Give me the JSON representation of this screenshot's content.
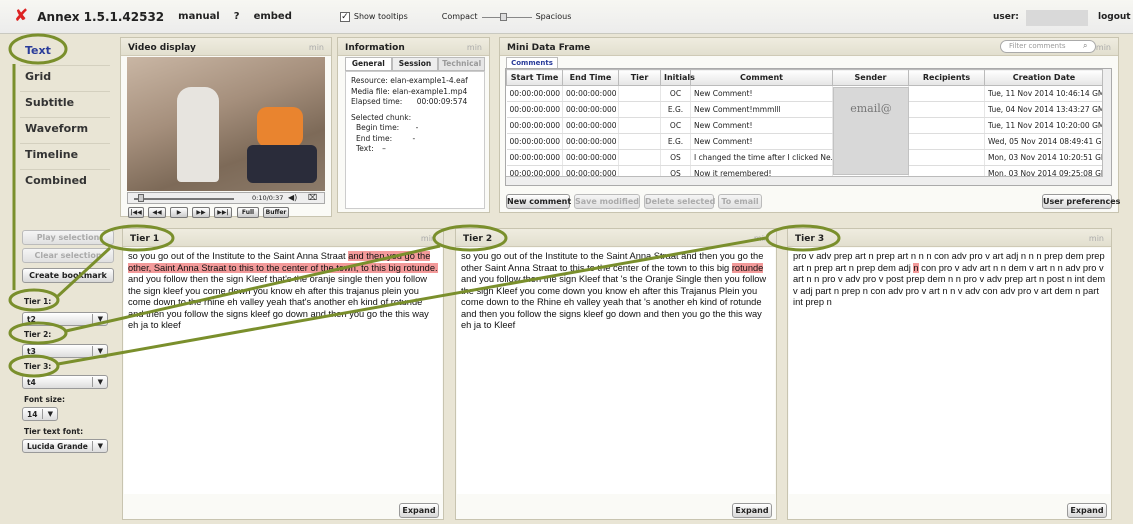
{
  "app": {
    "title": "Annex 1.5.1.42532",
    "manual": "manual",
    "help": "?",
    "embed": "embed",
    "tooltips_label": "Show tooltips",
    "compact": "Compact",
    "spacious": "Spacious",
    "user_label": "user:",
    "logout": "logout"
  },
  "nav": {
    "items": [
      "Text",
      "Grid",
      "Subtitle",
      "Waveform",
      "Timeline",
      "Combined"
    ],
    "active": "Text"
  },
  "video": {
    "title": "Video display",
    "min": "min",
    "time": "0:10/0:37",
    "full": "Full",
    "buffer": "Buffer"
  },
  "info": {
    "title": "Information",
    "min": "min",
    "tabs": [
      "General",
      "Session",
      "Technical"
    ],
    "resource": "Resource:  elan-example1-4.eaf",
    "media": "Media file:  elan-example1.mp4",
    "elapsed": "Elapsed time:",
    "elapsed_val": "00:00:09:574",
    "chunk": "Selected chunk:",
    "begin": "Begin time:",
    "begin_val": "-",
    "end": "End time:",
    "end_val": "-",
    "text": "Text:",
    "text_val": "–"
  },
  "mdf": {
    "title": "Mini Data Frame",
    "filter_placeholder": "Filter comments",
    "min": "min",
    "tab": "Comments",
    "columns": [
      "Start Time",
      "End Time",
      "Tier",
      "Initials",
      "Comment",
      "Sender",
      "Recipients",
      "Creation Date"
    ],
    "rows": [
      [
        "00:00:00:000",
        "00:00:00:000",
        "",
        "OC",
        "New Comment!",
        "",
        "",
        "Tue, 11 Nov 2014 10:46:14 GMT"
      ],
      [
        "00:00:00:000",
        "00:00:00:000",
        "",
        "E.G.",
        "New Comment!mmmlll",
        "",
        "",
        "Tue, 04 Nov 2014 13:43:27 GMT"
      ],
      [
        "00:00:00:000",
        "00:00:00:000",
        "",
        "OC",
        "New Comment!",
        "",
        "",
        "Tue, 11 Nov 2014 10:20:00 GMT"
      ],
      [
        "00:00:00:000",
        "00:00:00:000",
        "",
        "E.G.",
        "New Comment!",
        "",
        "",
        "Wed, 05 Nov 2014 08:49:41 GMT"
      ],
      [
        "00:00:00:000",
        "00:00:00:000",
        "",
        "OS",
        "I changed the time after I clicked Ne...",
        "",
        "",
        "Mon, 03 Nov 2014 10:20:51 GMT"
      ],
      [
        "00:00:00:000",
        "00:00:00:000",
        "",
        "OS",
        "Now it remembered!",
        "",
        "",
        "Mon, 03 Nov 2014 09:25:08 GMT"
      ]
    ],
    "email_overlay": "email@",
    "buttons": {
      "new": "New comment",
      "save": "Save modified",
      "delete": "Delete selected",
      "email": "To email",
      "prefs": "User preferences"
    }
  },
  "controls": {
    "play": "Play selection",
    "clear": "Clear selection",
    "bookmark": "Create bookmark",
    "tier1_label": "Tier 1:",
    "tier1_val": "t2",
    "tier2_label": "Tier 2:",
    "tier2_val": "t3",
    "tier3_label": "Tier 3:",
    "tier3_val": "t4",
    "font_size_label": "Font size:",
    "font_size_val": "14",
    "font_label": "Tier text font:",
    "font_val": "Lucida Grande"
  },
  "tiers": [
    {
      "title": "Tier 1",
      "min": "min",
      "t1": "so you go out of the Institute to the Saint Anna Straat ",
      "h1": "and then you go the other, Saint Anna Straat to this to the center of the town, to this big rotunde.",
      "t2": " and you follow then the sign Kleef that's the oranje single then you follow the sign kleef you come down you know eh after this trajanus plein you come down to the rhine eh valley yeah that's another eh kind of rotunde and then you follow the signs kleef go down and then you go the this way eh ja to kleef",
      "expand": "Expand"
    },
    {
      "title": "Tier 2",
      "min": "min",
      "t1": "so you go out of the Institute to the Saint Anna Straat and then you go the other Saint Anna Straat to this to the center of the town to this big ",
      "h1": "rotunde",
      "t2": " and you follow then the sign Kleef that 's the Oranje Single then you follow the sign Kleef you come down you know eh after this Trajanus Plein you come down to the Rhine eh valley yeah that 's another eh kind of rotunde and then you follow the signs kleef go down and then you go the this way eh ja to Kleef",
      "expand": "Expand"
    },
    {
      "title": "Tier 3",
      "min": "min",
      "t1": " pro v adv prep art n prep art n n n con adv pro v art adj n n n prep dem prep art n prep art n prep dem adj ",
      "h1": "n",
      "t2": " con pro v adv art n n dem v art n n adv pro v art n n pro v adv pro v post prep dem n n pro v adv prep art n post n int dem v adj part n prep n con adv pro v art n n v adv con adv pro v art dem n part int prep n",
      "expand": "Expand"
    }
  ]
}
